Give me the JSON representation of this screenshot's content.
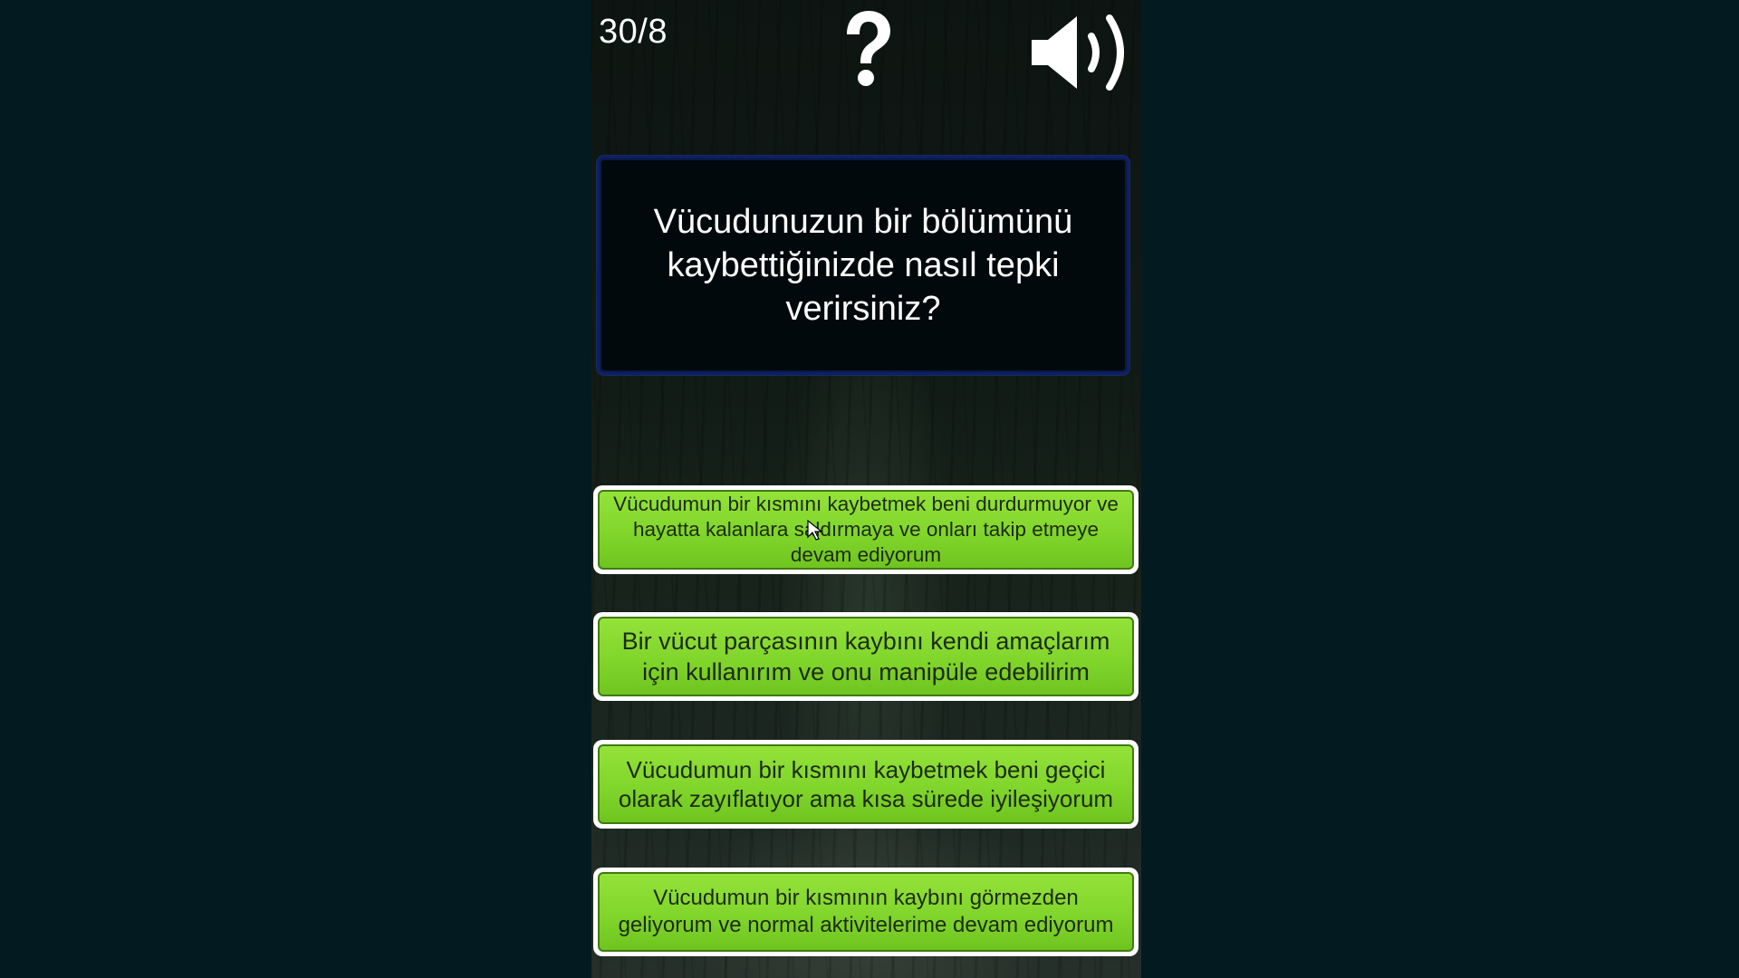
{
  "header": {
    "progress": "30/8",
    "help_icon": "question-mark-icon",
    "sound_icon": "speaker-sound-on-icon"
  },
  "question": {
    "text": "Vücudunuzun bir bölümünü kaybettiğinizde nasıl tepki verirsiniz?"
  },
  "answers": [
    {
      "text": "Vücudumun bir kısmını kaybetmek beni durdurmuyor ve hayatta kalanlara saldırmaya ve onları takip etmeye devam ediyorum"
    },
    {
      "text": "Bir vücut parçasının kaybını kendi amaçlarım için kullanırım ve onu manipüle edebilirim"
    },
    {
      "text": "Vücudumun bir kısmını kaybetmek beni geçici olarak zayıflatıyor ama kısa sürede iyileşiyorum"
    },
    {
      "text": "Vücudumun bir kısmının kaybını görmezden geliyorum ve normal aktivitelerime devam ediyorum"
    }
  ],
  "colors": {
    "answer_green": "#7fd42a",
    "question_bg": "#02090c",
    "question_border": "#0b1f6a",
    "outer_bg": "#031a20"
  }
}
